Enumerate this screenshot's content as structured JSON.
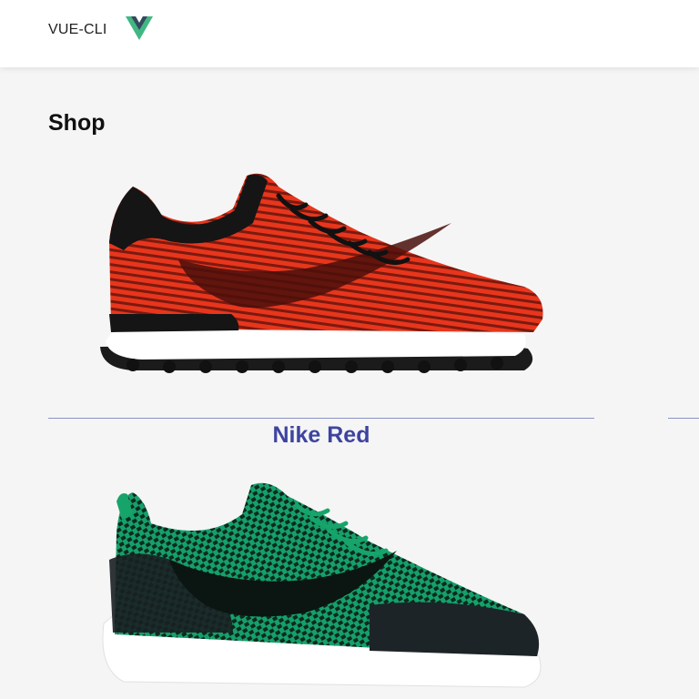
{
  "header": {
    "brand": "VUE-CLI",
    "logo_icon": "vue-logo-icon",
    "colors": {
      "logo_outer": "#41b883",
      "logo_inner": "#35495e"
    }
  },
  "page": {
    "title": "Shop"
  },
  "products": [
    {
      "name": "Nike Red",
      "image_icon": "red-sneaker-image",
      "name_color": "#3d44a0"
    },
    {
      "image_icon": "green-sneaker-image"
    }
  ]
}
